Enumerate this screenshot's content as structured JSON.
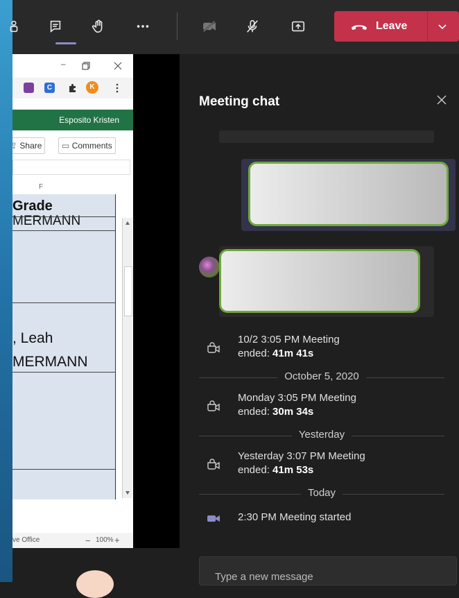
{
  "toolbar": {
    "leave_label": "Leave"
  },
  "excel": {
    "user": "Esposito Kristen",
    "share_label": "Share",
    "comments_label": "Comments",
    "column_letter": "F",
    "cell_grade": "Grade",
    "cell_name1": "MERMANN",
    "cell_name2": ", Leah",
    "cell_name3": "MERMANN",
    "status_left": "ve Office",
    "zoom": "100%",
    "minimize": "–",
    "ext_avatar": "K",
    "ext_c": "C"
  },
  "chat": {
    "title": "Meeting chat",
    "events": [
      {
        "line1": "10/2 3:05 PM   Meeting",
        "ended_prefix": "ended: ",
        "duration": "41m 41s"
      },
      {
        "line1": "Monday 3:05 PM   Meeting",
        "ended_prefix": "ended: ",
        "duration": "30m 34s"
      },
      {
        "line1": "Yesterday 3:07 PM   Meeting",
        "ended_prefix": "ended: ",
        "duration": "41m 53s"
      },
      {
        "line1": "2:30 PM   Meeting started"
      }
    ],
    "separators": [
      "October 5, 2020",
      "Yesterday",
      "Today"
    ],
    "compose_placeholder": "Type a new message"
  },
  "colors": {
    "leave_red": "#c4314b",
    "bubble_border": "#70a83c",
    "excel_green": "#217346",
    "accent": "#8b8cc7"
  }
}
